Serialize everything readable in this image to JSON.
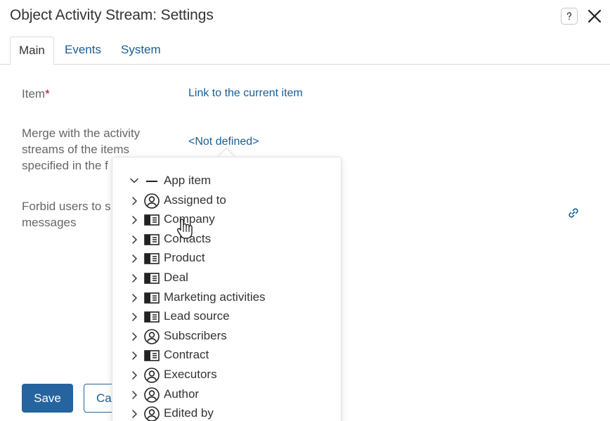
{
  "window": {
    "title": "Object Activity Stream: Settings"
  },
  "tabs": [
    {
      "label": "Main",
      "active": true
    },
    {
      "label": "Events",
      "active": false
    },
    {
      "label": "System",
      "active": false
    }
  ],
  "form": {
    "item": {
      "label": "Item",
      "required_mark": "*",
      "value": "Link to the current item"
    },
    "merge": {
      "label_line1": "Merge with the activity",
      "label_line2": "streams of the items",
      "label_line3": "specified in the f",
      "value": "<Not defined>"
    },
    "forbid": {
      "label_line1": "Forbid users to s",
      "label_line2": "messages"
    }
  },
  "buttons": {
    "save": "Save",
    "cancel": "Ca"
  },
  "tree": {
    "root": {
      "label": "App item",
      "icon": "minus-icon"
    },
    "items": [
      {
        "label": "Assigned to",
        "icon": "user-circle-icon"
      },
      {
        "label": "Company",
        "icon": "app-item-icon"
      },
      {
        "label": "Contacts",
        "icon": "app-item-icon"
      },
      {
        "label": "Product",
        "icon": "app-item-icon"
      },
      {
        "label": "Deal",
        "icon": "app-item-icon"
      },
      {
        "label": "Marketing activities",
        "icon": "app-item-icon"
      },
      {
        "label": "Lead source",
        "icon": "app-item-icon"
      },
      {
        "label": "Subscribers",
        "icon": "user-circle-icon"
      },
      {
        "label": "Contract",
        "icon": "app-item-icon"
      },
      {
        "label": "Executors",
        "icon": "user-circle-icon"
      },
      {
        "label": "Author",
        "icon": "user-circle-icon"
      },
      {
        "label": "Edited by",
        "icon": "user-circle-icon"
      }
    ]
  },
  "colors": {
    "link": "#1a5d96",
    "primary": "#25649e",
    "required": "#d0021b"
  }
}
